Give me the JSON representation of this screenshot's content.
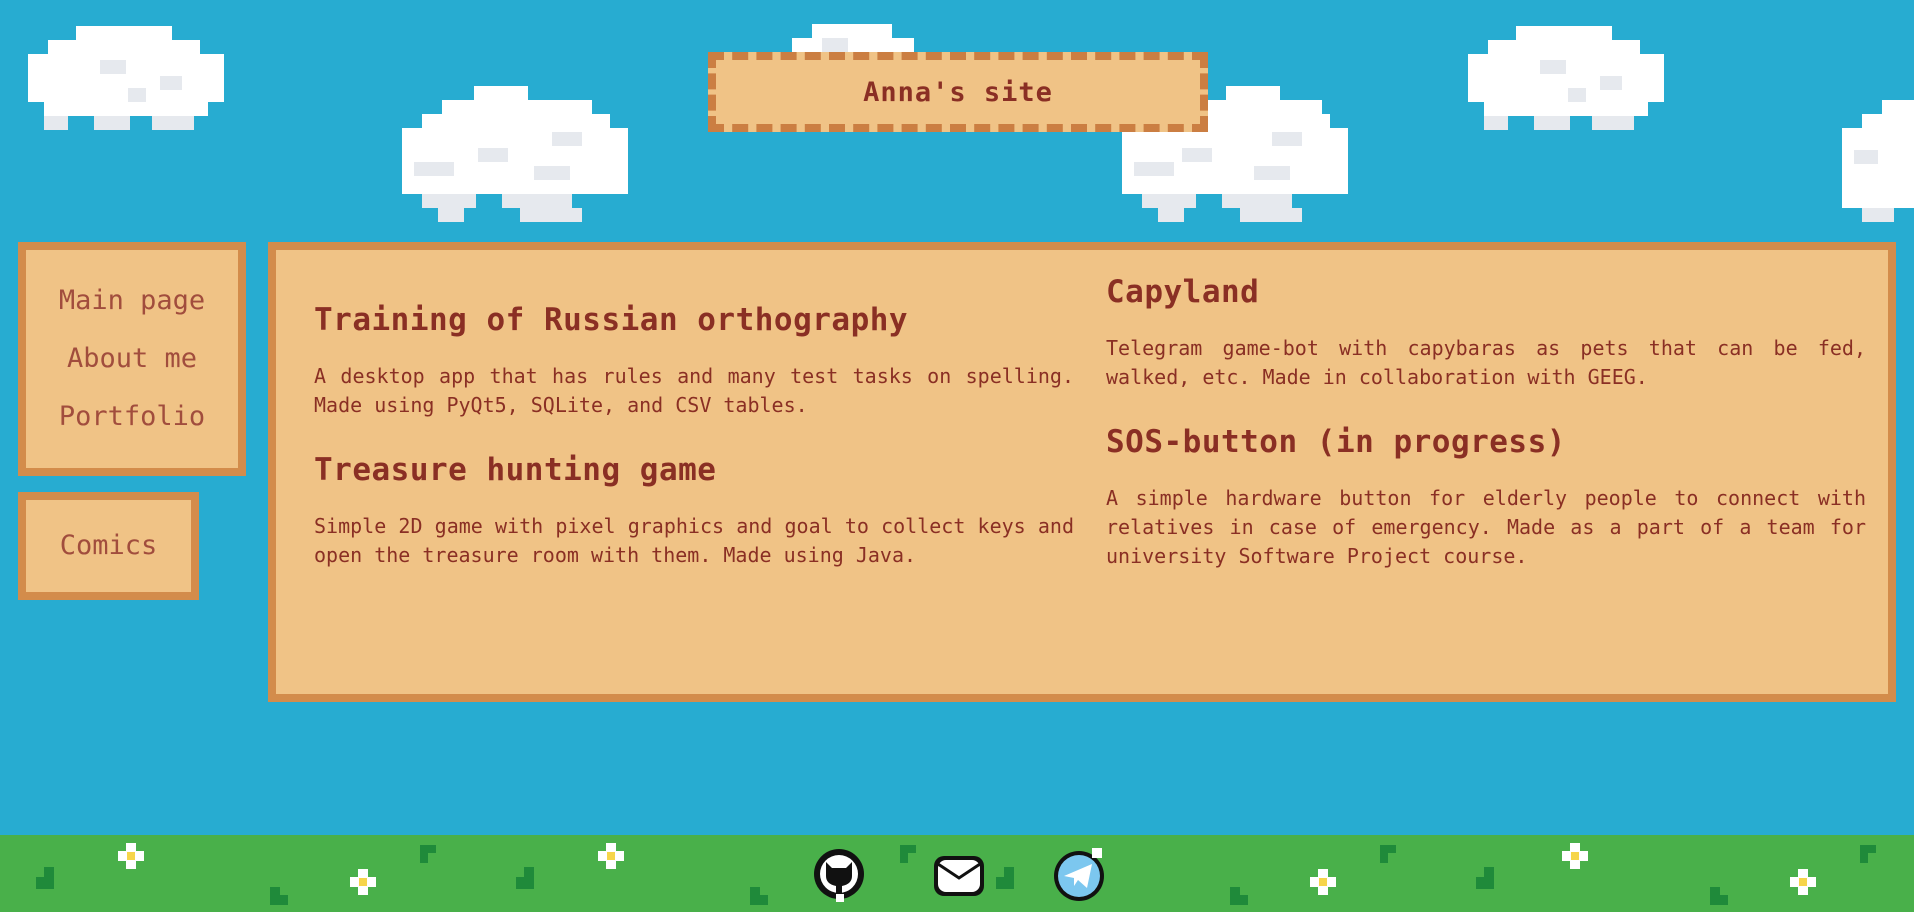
{
  "site": {
    "title": "Anna's site"
  },
  "nav": {
    "items": [
      {
        "label": "Main page"
      },
      {
        "label": "About me"
      },
      {
        "label": "Portfolio"
      }
    ],
    "comics_label": "Comics"
  },
  "projects": {
    "left": [
      {
        "title": "Training of Russian orthography",
        "description": "A desktop app that has rules and many test tasks on spelling. Made using PyQt5, SQLite, and CSV tables."
      },
      {
        "title": "Treasure hunting game",
        "description": "Simple 2D game with pixel graphics and goal to collect keys and open the treasure room with them. Made using Java."
      }
    ],
    "right": [
      {
        "title": "Capyland",
        "description": "Telegram game-bot with capybaras as pets that can be fed, walked, etc. Made in collaboration with GEEG."
      },
      {
        "title": "SOS-button (in progress)",
        "description": "A simple hardware button for elderly people to connect with relatives in case of emergency. Made as a part of a team for university Software Project course."
      }
    ]
  },
  "footer": {
    "icons": [
      {
        "name": "github-icon"
      },
      {
        "name": "mail-icon"
      },
      {
        "name": "telegram-icon"
      }
    ]
  },
  "colors": {
    "sky": "#27acd1",
    "panel": "#f0c386",
    "panel_border": "#d38c4b",
    "text": "#8a2f24",
    "grass": "#49b04a"
  }
}
